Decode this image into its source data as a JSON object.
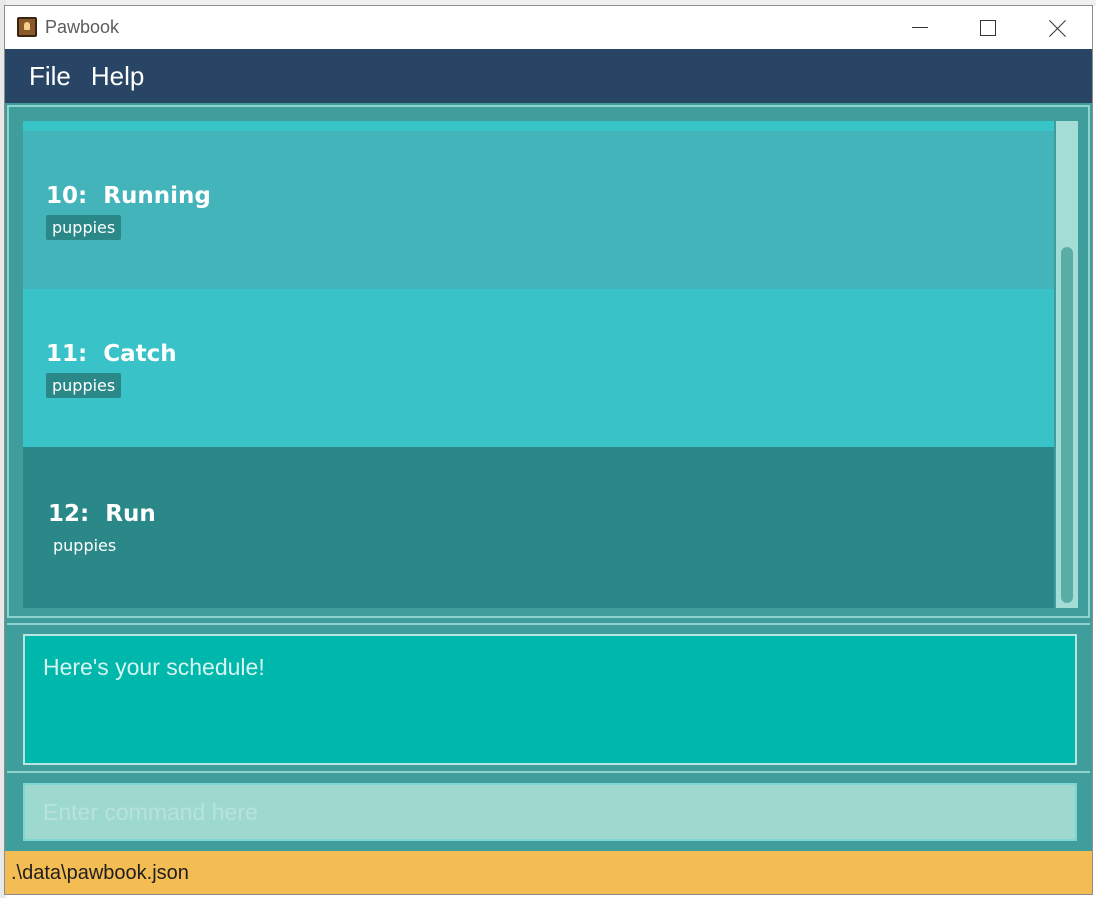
{
  "window": {
    "title": "Pawbook"
  },
  "menu": {
    "items": [
      "File",
      "Help"
    ]
  },
  "schedule": {
    "entries": [
      {
        "index": "10:",
        "name": "Running",
        "tag": "puppies",
        "bg": "#44b4bb"
      },
      {
        "index": "11:",
        "name": "Catch",
        "tag": "puppies",
        "bg": "#39c3c8"
      },
      {
        "index": "12:",
        "name": "Run",
        "tag": "puppies",
        "bg": "#2a8889"
      }
    ]
  },
  "result": {
    "text": "Here's your schedule!"
  },
  "command": {
    "placeholder": "Enter command here",
    "value": ""
  },
  "status": {
    "path": ".\\data\\pawbook.json"
  },
  "colors": {
    "menubar": "#284565",
    "panel": "#3f9e9c",
    "result_box": "#00b7ab",
    "status_bar": "#f4bd54"
  }
}
